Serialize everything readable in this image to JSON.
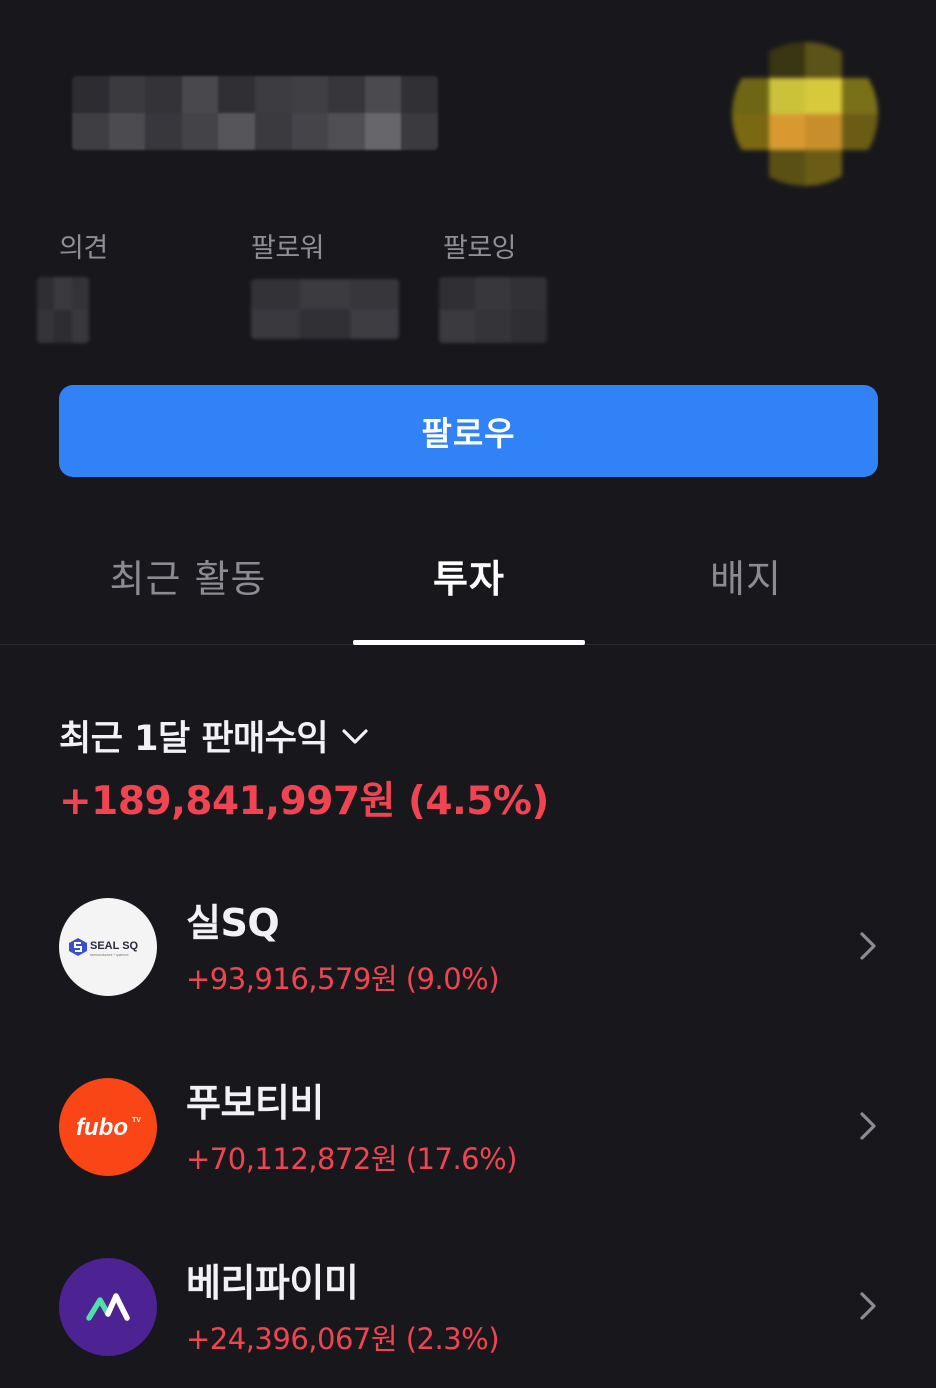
{
  "profile": {
    "stats": [
      {
        "label": "의견"
      },
      {
        "label": "팔로워"
      },
      {
        "label": "팔로잉"
      }
    ],
    "follow_label": "팔로우"
  },
  "tabs": [
    {
      "label": "최근 활동",
      "active": false
    },
    {
      "label": "투자",
      "active": true
    },
    {
      "label": "배지",
      "active": false
    }
  ],
  "summary": {
    "period_title": "최근 1달 판매수익",
    "value": "+189,841,997원 (4.5%)"
  },
  "stocks": [
    {
      "name": "실SQ",
      "return": "+93,916,579원 (9.0%)",
      "logo_text": "SEAL SQ",
      "logo_subtext": "semiconductors + quantum"
    },
    {
      "name": "푸보티비",
      "return": "+70,112,872원 (17.6%)",
      "logo_text": "fubo",
      "logo_superscript": "TV"
    },
    {
      "name": "베리파이미",
      "return": "+24,396,067원 (2.3%)",
      "logo_text": "VM"
    }
  ],
  "colors": {
    "background": "#18181c",
    "accent_blue": "#3182f6",
    "gain_red": "#f04452",
    "muted_text": "#8e8e95",
    "fubo_orange": "#fa4616",
    "verifyme_purple": "#4d2293"
  },
  "icons": {
    "summary_toggle": "chevron-down-icon",
    "row_link": "chevron-right-icon"
  }
}
